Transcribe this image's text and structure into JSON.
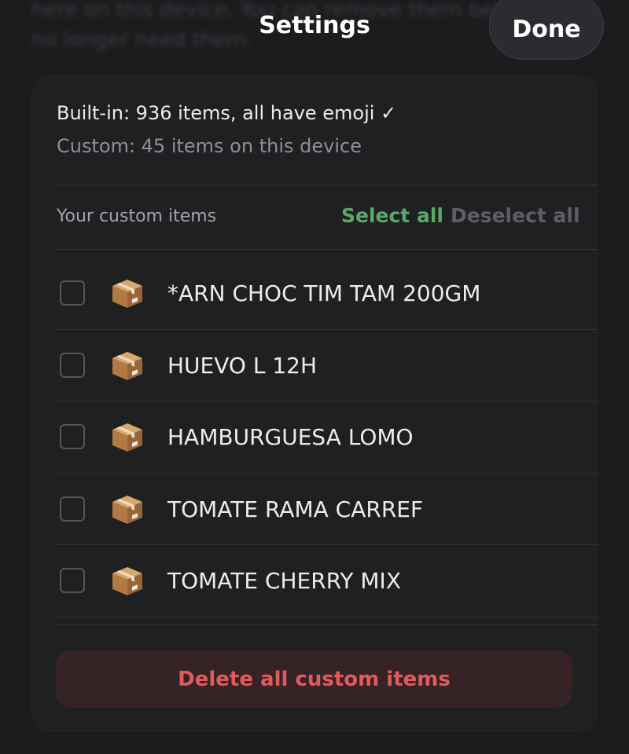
{
  "background": {
    "line1": "here on this device. You can remove them below if you",
    "line2": "no longer need them."
  },
  "header": {
    "title": "Settings",
    "done_label": "Done"
  },
  "summary": {
    "builtin": "Built-in: 936 items, all have emoji ✓",
    "custom": "Custom: 45 items on this device"
  },
  "custom_section": {
    "label": "Your custom items",
    "select_all": "Select all",
    "deselect_all": "Deselect all"
  },
  "items": [
    {
      "icon": "package-icon",
      "name": "*ARN CHOC TIM TAM 200GM",
      "checked": false
    },
    {
      "icon": "package-icon",
      "name": "HUEVO L 12H",
      "checked": false
    },
    {
      "icon": "package-icon",
      "name": "HAMBURGUESA LOMO",
      "checked": false
    },
    {
      "icon": "package-icon",
      "name": "TOMATE RAMA CARREF",
      "checked": false
    },
    {
      "icon": "package-icon",
      "name": "TOMATE CHERRY MIX",
      "checked": false
    }
  ],
  "actions": {
    "delete_all": "Delete all custom items"
  },
  "colors": {
    "background": "#1c1c1f",
    "card": "#1f2022",
    "accent_green": "#5aa86a",
    "destructive_red": "#e25a5a",
    "destructive_bg": "#352326"
  }
}
